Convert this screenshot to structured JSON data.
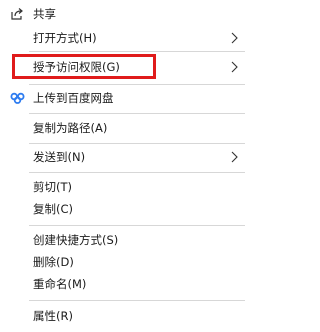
{
  "menu": {
    "items": [
      {
        "label": "共享",
        "icon": "share-icon"
      },
      {
        "label": "打开方式(H)"
      },
      {
        "label": "授予访问权限(G)"
      },
      {
        "label": "上传到百度网盘",
        "icon": "baidu-netdisk-icon"
      },
      {
        "label": "复制为路径(A)"
      },
      {
        "label": "发送到(N)"
      },
      {
        "label": "剪切(T)"
      },
      {
        "label": "复制(C)"
      },
      {
        "label": "创建快捷方式(S)"
      },
      {
        "label": "删除(D)"
      },
      {
        "label": "重命名(M)"
      },
      {
        "label": "属性(R)"
      }
    ]
  },
  "colors": {
    "highlight_border": "#e01b1b",
    "baidu_blue": "#2d7cf0",
    "separator": "#d7d7d7"
  }
}
